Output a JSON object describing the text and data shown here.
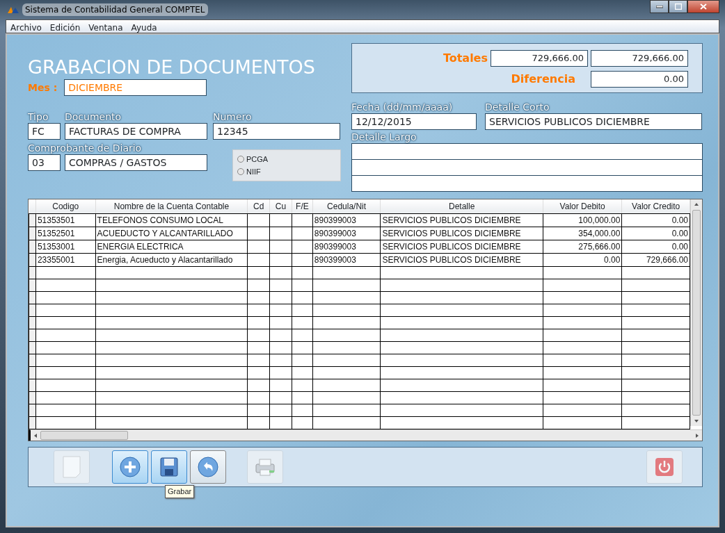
{
  "window": {
    "title": "Sistema de Contabilidad General COMPTEL"
  },
  "menu": [
    "Archivo",
    "Edición",
    "Ventana",
    "Ayuda"
  ],
  "form": {
    "title": "GRABACION DE DOCUMENTOS",
    "mes_label": "Mes :",
    "mes": "DICIEMBRE",
    "tipo_label": "Tipo",
    "tipo": "FC",
    "documento_label": "Documento",
    "documento": "FACTURAS DE COMPRA",
    "numero_label": "Numero",
    "numero": "12345",
    "comprobante_label": "Comprobante de Diario",
    "comprobante_code": "03",
    "comprobante": "COMPRAS / GASTOS",
    "norma": [
      {
        "label": "PCGA",
        "selected": false
      },
      {
        "label": "NIIF",
        "selected": false
      }
    ],
    "fecha_label": "Fecha (dd/mm/aaaa)",
    "fecha": "12/12/2015",
    "detalle_corto_label": "Detalle Corto",
    "detalle_corto": "SERVICIOS PUBLICOS DICIEMBRE",
    "detalle_largo_label": "Detalle Largo"
  },
  "totals": {
    "totales_label": "Totales",
    "total_debito": "729,666.00",
    "total_credito": "729,666.00",
    "diferencia_label": "Diferencia",
    "diferencia": "0.00"
  },
  "table": {
    "columns": [
      "Codigo",
      "Nombre de la Cuenta Contable",
      "Cd",
      "Cu",
      "F/E",
      "Cedula/Nit",
      "Detalle",
      "Valor Debito",
      "Valor Credito"
    ],
    "rows": [
      [
        "51353501",
        "TELEFONOS CONSUMO LOCAL",
        "",
        "",
        "",
        "890399003",
        "SERVICIOS PUBLICOS DICIEMBRE",
        "100,000.00",
        "0.00"
      ],
      [
        "51352501",
        "ACUEDUCTO Y ALCANTARILLADO",
        "",
        "",
        "",
        "890399003",
        "SERVICIOS PUBLICOS DICIEMBRE",
        "354,000.00",
        "0.00"
      ],
      [
        "51353001",
        "ENERGIA ELECTRICA",
        "",
        "",
        "",
        "890399003",
        "SERVICIOS PUBLICOS DICIEMBRE",
        "275,666.00",
        "0.00"
      ],
      [
        "23355001",
        "Energia, Acueducto y Alacantarillado",
        "",
        "",
        "",
        "890399003",
        "SERVICIOS PUBLICOS DICIEMBRE",
        "0.00",
        "729,666.00"
      ]
    ]
  },
  "toolbar": [
    {
      "kind": "new",
      "disabled": true
    },
    {
      "kind": "add",
      "disabled": false
    },
    {
      "kind": "save",
      "disabled": false,
      "tooltip": "Grabar"
    },
    {
      "kind": "undo",
      "disabled": false
    },
    {
      "kind": "print",
      "disabled": true
    },
    {
      "kind": "power",
      "disabled": true
    }
  ]
}
